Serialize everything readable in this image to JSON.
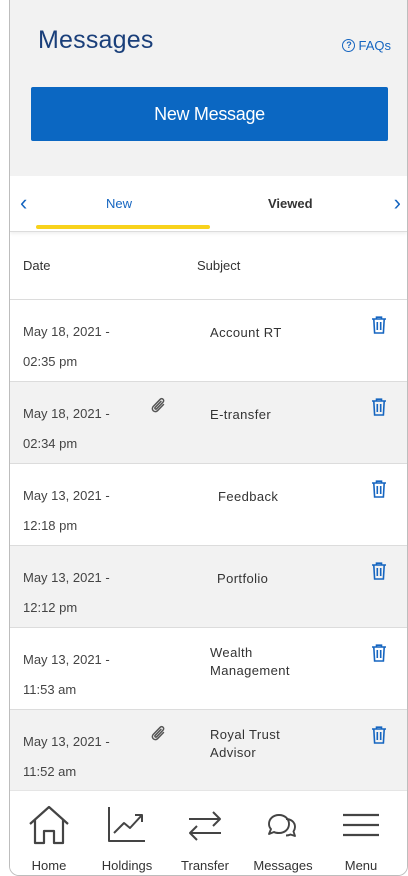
{
  "header": {
    "title": "Messages",
    "faqs_label": "FAQs",
    "new_message_label": "New Message"
  },
  "tabs": {
    "items": [
      {
        "label": "New",
        "selected": true
      },
      {
        "label": "Viewed",
        "selected": false
      }
    ]
  },
  "table": {
    "columns": [
      "Date",
      "Subject"
    ],
    "rows": [
      {
        "date": "May 18, 2021 -",
        "time": "02:35 pm",
        "subject": "Account RT",
        "attachment": false
      },
      {
        "date": "May 18, 2021 -",
        "time": "02:34 pm",
        "subject": "E-transfer",
        "attachment": true
      },
      {
        "date": "May 13, 2021 -",
        "time": "12:18 pm",
        "subject": "Feedback",
        "attachment": false
      },
      {
        "date": "May 13, 2021 -",
        "time": "12:12 pm",
        "subject": "Portfolio",
        "attachment": false
      },
      {
        "date": "May 13, 2021 -",
        "time": "11:53 am",
        "subject": "Wealth Management",
        "attachment": false
      },
      {
        "date": "May 13, 2021 -",
        "time": "11:52 am",
        "subject": "Royal Trust Advisor",
        "attachment": true
      }
    ]
  },
  "bottom_nav": {
    "items": [
      {
        "label": "Home",
        "icon": "home-icon"
      },
      {
        "label": "Holdings",
        "icon": "holdings-icon"
      },
      {
        "label": "Transfer",
        "icon": "transfer-icon"
      },
      {
        "label": "Messages",
        "icon": "messages-icon"
      },
      {
        "label": "Menu",
        "icon": "menu-icon"
      }
    ]
  },
  "colors": {
    "brand_blue": "#0b67c2",
    "title_navy": "#1a3f7a",
    "link_blue": "#1565c0",
    "tab_underline": "#f8d21c"
  }
}
